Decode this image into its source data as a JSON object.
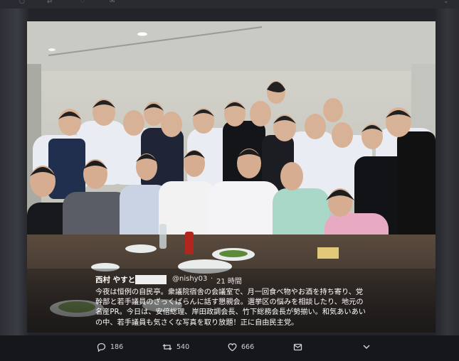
{
  "tweet": {
    "author_name": "西村 やすとし",
    "handle": "@nishy03",
    "separator": "·",
    "time": "21 時間",
    "text": "今夜は恒例の自民亭。衆議院宿舎の会議室で、月一回食べ物やお酒を持ち寄り、党幹部と若手議員のざっくばらんに話す懇親会。選挙区の悩みを相談したり、地元の名産PR。今日は、安倍総理、岸田政調会長、竹下総務会長が勢揃い。和気あいあいの中、若手議員も気さくな写真を取り放題！正に自由民主党。"
  },
  "actions": {
    "reply_count": "186",
    "retweet_count": "540",
    "like_count": "666"
  },
  "icons": [
    "reply-icon",
    "retweet-icon",
    "like-icon",
    "message-icon",
    "chevron-down-icon"
  ]
}
